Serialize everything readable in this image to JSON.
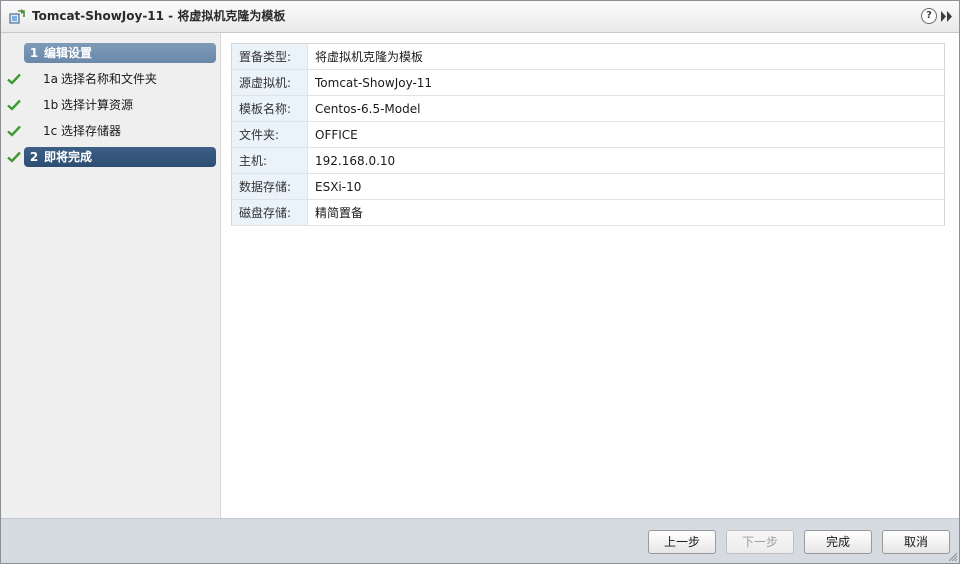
{
  "window": {
    "title": "Tomcat-ShowJoy-11 - 将虚拟机克隆为模板",
    "help_label": "?",
    "icons": {
      "title": "clone-vm-icon",
      "help": "help-icon",
      "expand": "double-chevron-right-icon",
      "completed": "checkmark-icon"
    }
  },
  "steps": [
    {
      "num": "1",
      "label": "编辑设置",
      "completed": false,
      "active": false
    },
    {
      "num": "1a",
      "label": "选择名称和文件夹",
      "completed": true
    },
    {
      "num": "1b",
      "label": "选择计算资源",
      "completed": true
    },
    {
      "num": "1c",
      "label": "选择存储器",
      "completed": true
    },
    {
      "num": "2",
      "label": "即将完成",
      "completed": true,
      "active": true
    }
  ],
  "review": [
    {
      "key": "置备类型:",
      "value": "将虚拟机克隆为模板"
    },
    {
      "key": "源虚拟机:",
      "value": "Tomcat-ShowJoy-11"
    },
    {
      "key": "模板名称:",
      "value": "Centos-6.5-Model"
    },
    {
      "key": "文件夹:",
      "value": "OFFICE"
    },
    {
      "key": "主机:",
      "value": "192.168.0.10"
    },
    {
      "key": "数据存储:",
      "value": "ESXi-10"
    },
    {
      "key": "磁盘存储:",
      "value": "精简置备"
    }
  ],
  "buttons": {
    "back": "上一步",
    "next": "下一步",
    "finish": "完成",
    "cancel": "取消"
  },
  "colors": {
    "step_header": "#7592b1",
    "step_active": "#35567c",
    "check": "#3c9a2e",
    "key_bg": "#eaf2fa",
    "footer_bg": "#d6dbe2"
  }
}
